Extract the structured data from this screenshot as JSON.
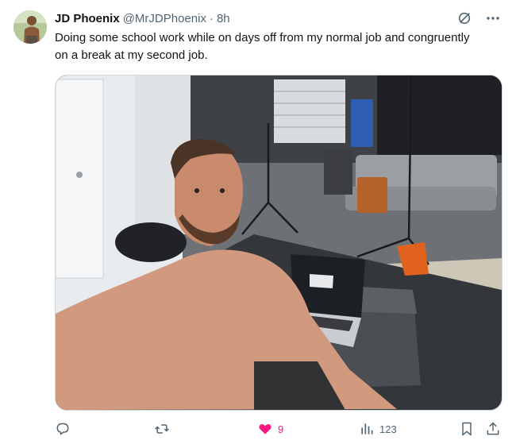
{
  "author": {
    "display_name": "JD Phoenix",
    "handle": "@MrJDPhoenix",
    "separator": "·",
    "time": "8h"
  },
  "tweet": {
    "text": "Doing some school work while on days off from my normal job and congruently on a break at my second job."
  },
  "media": {
    "description_icon": "photo"
  },
  "actions": {
    "reply_count": "",
    "retweet_count": "",
    "like_count": "9",
    "views_count": "123"
  },
  "colors": {
    "like_active": "#f91880",
    "secondary_text": "#536471"
  }
}
